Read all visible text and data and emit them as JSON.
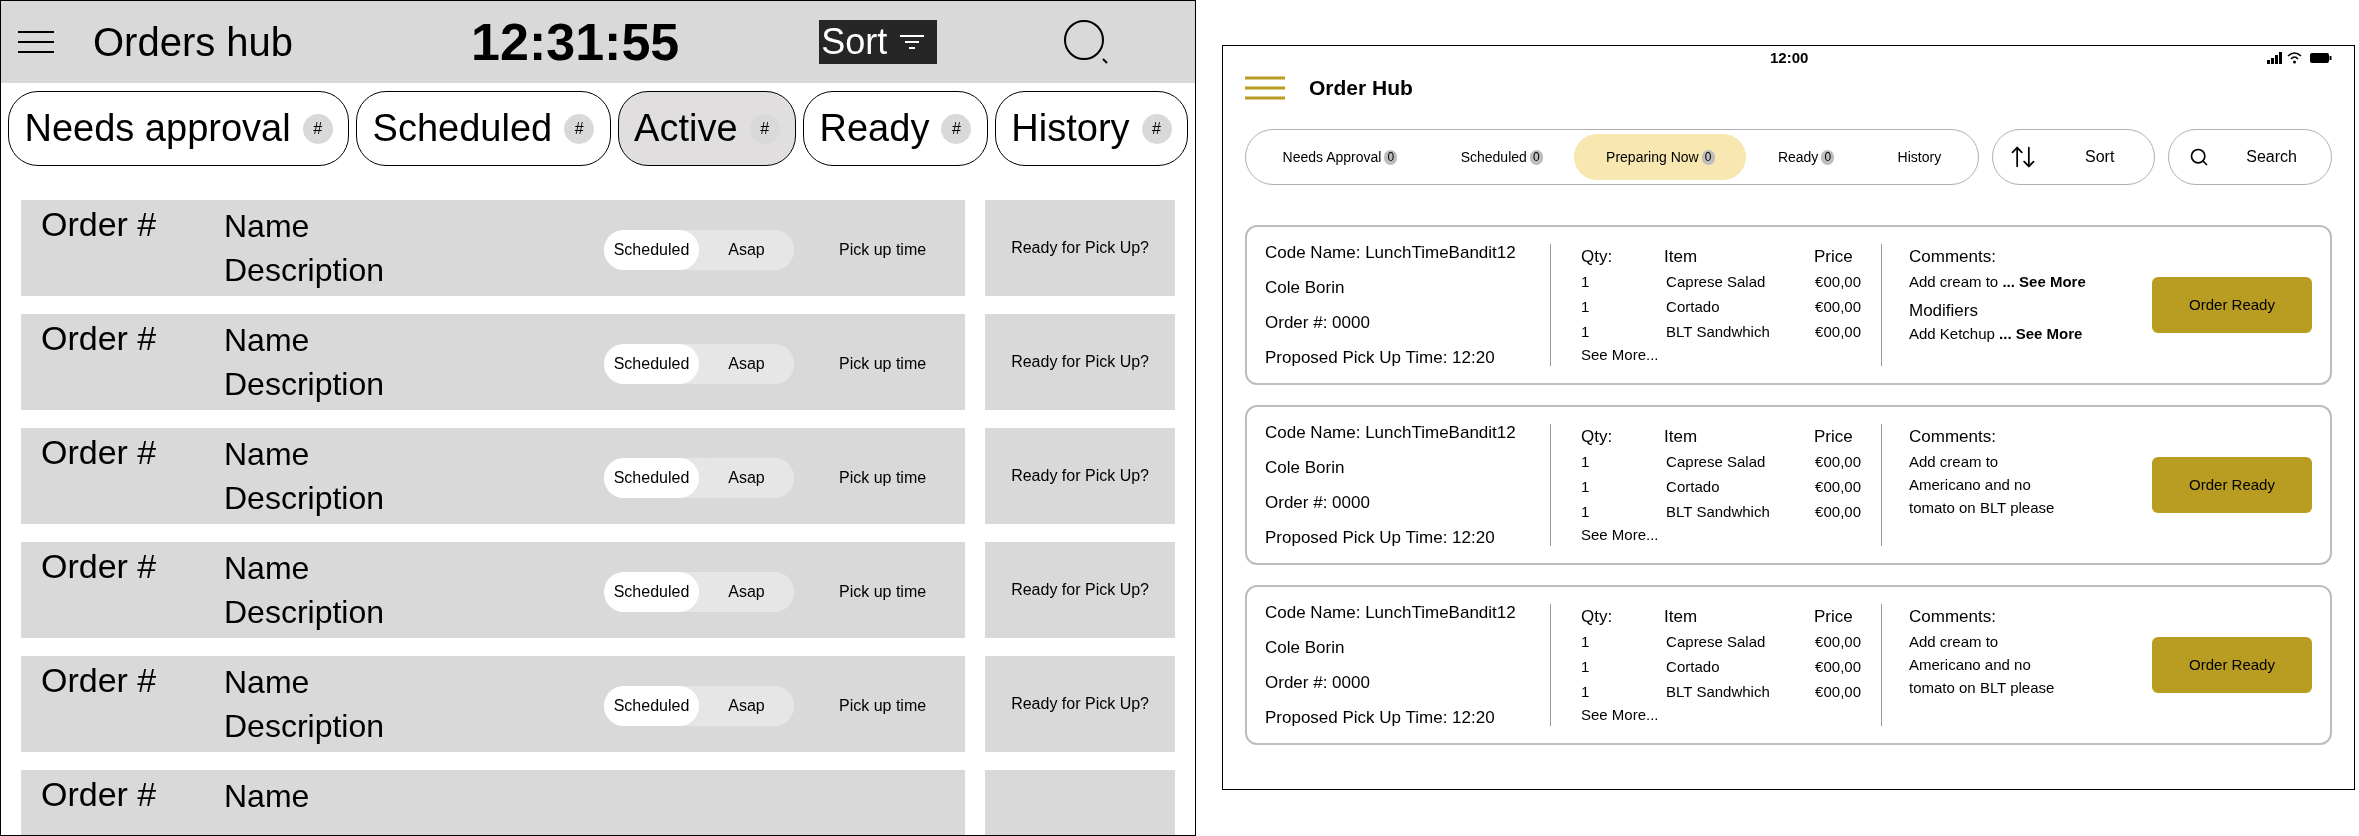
{
  "left_app": {
    "header": {
      "title": "Orders hub",
      "clock": "12:31:55",
      "sort_label": "Sort"
    },
    "tabs": [
      {
        "label": "Needs approval",
        "count": "#",
        "selected": false
      },
      {
        "label": "Scheduled",
        "count": "#",
        "selected": false
      },
      {
        "label": "Active",
        "count": "#",
        "selected": true
      },
      {
        "label": "Ready",
        "count": "#",
        "selected": false
      },
      {
        "label": "History",
        "count": "#",
        "selected": false
      }
    ],
    "rows": [
      {
        "kind": "full",
        "order": "Order #",
        "name": "Name",
        "description": "Description",
        "toggle": [
          {
            "label": "Scheduled",
            "selected": true
          },
          {
            "label": "Asap",
            "selected": false
          }
        ],
        "pickup": "Pick up time",
        "ready": "Ready for Pick Up?"
      },
      {
        "kind": "full",
        "order": "Order #",
        "name": "Name",
        "description": "Description",
        "toggle": [
          {
            "label": "Scheduled",
            "selected": true
          },
          {
            "label": "Asap",
            "selected": false
          }
        ],
        "pickup": "Pick up time",
        "ready": "Ready for Pick Up?"
      },
      {
        "kind": "full",
        "order": "Order #",
        "name": "Name",
        "description": "Description",
        "toggle": [
          {
            "label": "Scheduled",
            "selected": true
          },
          {
            "label": "Asap",
            "selected": false
          }
        ],
        "pickup": "Pick up time",
        "ready": "Ready for Pick Up?"
      },
      {
        "kind": "full",
        "order": "Order #",
        "name": "Name",
        "description": "Description",
        "toggle": [
          {
            "label": "Scheduled",
            "selected": true
          },
          {
            "label": "Asap",
            "selected": false
          }
        ],
        "pickup": "Pick up time",
        "ready": "Ready for Pick Up?"
      },
      {
        "kind": "full",
        "order": "Order #",
        "name": "Name",
        "description": "Description",
        "toggle": [
          {
            "label": "Scheduled",
            "selected": true
          },
          {
            "label": "Asap",
            "selected": false
          }
        ],
        "pickup": "Pick up time",
        "ready": "Ready for Pick Up?"
      },
      {
        "kind": "partial",
        "order": "Order #",
        "name": "Name"
      }
    ]
  },
  "right_app": {
    "status_bar": {
      "time": "12:00"
    },
    "header": {
      "title": "Order Hub"
    },
    "tabs": [
      {
        "label": "Needs Approval",
        "count": "0",
        "selected": false
      },
      {
        "label": "Scheduled",
        "count": "0",
        "selected": false
      },
      {
        "label": "Preparing  Now",
        "count": "0",
        "selected": true
      },
      {
        "label": "Ready",
        "count": "0",
        "selected": false
      },
      {
        "label": "History",
        "selected": false
      }
    ],
    "sort_label": "Sort",
    "search_label": "Search",
    "cards": [
      {
        "code_name": "Code Name: LunchTimeBandit12",
        "customer": "Cole Borin",
        "order_no": "Order #: 0000",
        "pickup": "Proposed Pick Up Time: 12:20",
        "headers": [
          "Qty:",
          "Item",
          "Price"
        ],
        "items": [
          {
            "qty": "1",
            "item": "Caprese Salad",
            "price": "€00,00"
          },
          {
            "qty": "1",
            "item": "Cortado",
            "price": "€00,00"
          },
          {
            "qty": "1",
            "item": "BLT Sandwhich",
            "price": "€00,00"
          }
        ],
        "see_more": "See More...",
        "comments_title": "Comments:",
        "comments": "Add cream to **... See More**",
        "modifiers_title": "Modifiers",
        "modifiers": "Add Ketchup **... See More**",
        "button": "Order Ready"
      },
      {
        "code_name": "Code Name: LunchTimeBandit12",
        "customer": "Cole Borin",
        "order_no": "Order #: 0000",
        "pickup": "Proposed Pick Up Time: 12:20",
        "headers": [
          "Qty:",
          "Item",
          "Price"
        ],
        "items": [
          {
            "qty": "1",
            "item": "Caprese Salad",
            "price": "€00,00"
          },
          {
            "qty": "1",
            "item": "Cortado",
            "price": "€00,00"
          },
          {
            "qty": "1",
            "item": "BLT Sandwhich",
            "price": "€00,00"
          }
        ],
        "see_more": "See More...",
        "comments_title": "Comments:",
        "comments": "Add cream to Americano and no tomato on BLT please",
        "button": "Order Ready"
      },
      {
        "code_name": "Code Name: LunchTimeBandit12",
        "customer": "Cole Borin",
        "order_no": "Order #: 0000",
        "pickup": "Proposed Pick Up Time: 12:20",
        "headers": [
          "Qty:",
          "Item",
          "Price"
        ],
        "items": [
          {
            "qty": "1",
            "item": "Caprese Salad",
            "price": "€00,00"
          },
          {
            "qty": "1",
            "item": "Cortado",
            "price": "€00,00"
          },
          {
            "qty": "1",
            "item": "BLT Sandwhich",
            "price": "€00,00"
          }
        ],
        "see_more": "See More...",
        "comments_title": "Comments:",
        "comments": "Add cream to Americano and no tomato on BLT please",
        "button": "Order Ready"
      }
    ]
  }
}
